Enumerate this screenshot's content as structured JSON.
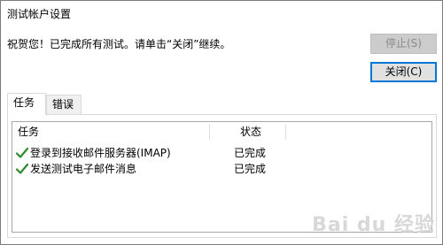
{
  "window": {
    "title": "测试帐户设置"
  },
  "message": "祝贺您！已完成所有测试。请单击“关闭”继续。",
  "buttons": {
    "stop": "停止(S)",
    "close": "关闭(C)"
  },
  "tabs": [
    {
      "label": "任务",
      "selected": true
    },
    {
      "label": "错误",
      "selected": false
    }
  ],
  "table": {
    "columns": [
      "任务",
      "状态"
    ],
    "rows": [
      {
        "task": "登录到接收邮件服务器(IMAP)",
        "status": "已完成",
        "icon": "check-icon"
      },
      {
        "task": "发送测试电子邮件消息",
        "status": "已完成",
        "icon": "check-icon"
      }
    ]
  },
  "watermark": "Bai du 经验",
  "colors": {
    "accent": "#0078d7",
    "check": "#2e8b2e",
    "disabled_bg": "#cccccc"
  }
}
